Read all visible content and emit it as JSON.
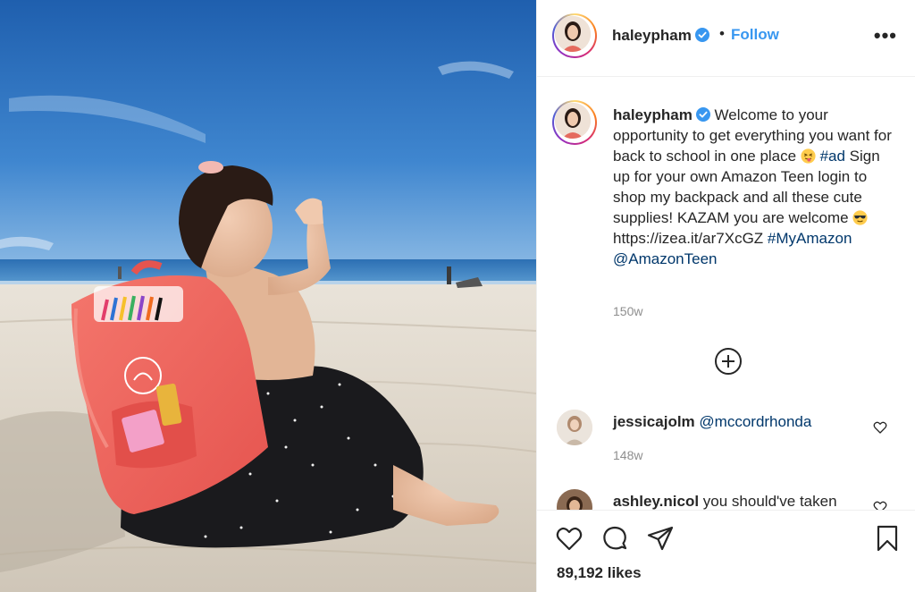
{
  "post": {
    "username": "haleypham",
    "follow_label": "Follow",
    "separator": "•",
    "more_label": "•••",
    "photo_icon": "beach-photo",
    "verified_color": "#3897f0"
  },
  "caption": {
    "username": "haleypham",
    "text_part1": "Welcome to your opportunity to get everything you want for back to school in one place",
    "emoji1": "face-with-tongue-emoji",
    "hashtag_ad": "#ad",
    "text_part2": "Sign up for your own Amazon Teen login to shop my backpack and all these cute supplies! KAZAM you are welcome",
    "emoji2": "sunglasses-emoji",
    "link": "https://izea.it/ar7XcGZ",
    "hashtag_myamazon": "#MyAmazon",
    "mention": "@AmazonTeen",
    "time": "150w"
  },
  "comments": [
    {
      "username": "jessicajolm",
      "text": "@mccordrhonda",
      "time": "148w"
    },
    {
      "username": "ashley.nicol",
      "text": "you should've taken",
      "time": ""
    }
  ],
  "actions": {
    "likes": "89,192 likes"
  },
  "colors": {
    "link": "#00376b",
    "follow": "#3897f0",
    "secondary_text": "#8e8e8e",
    "text": "#262626"
  }
}
